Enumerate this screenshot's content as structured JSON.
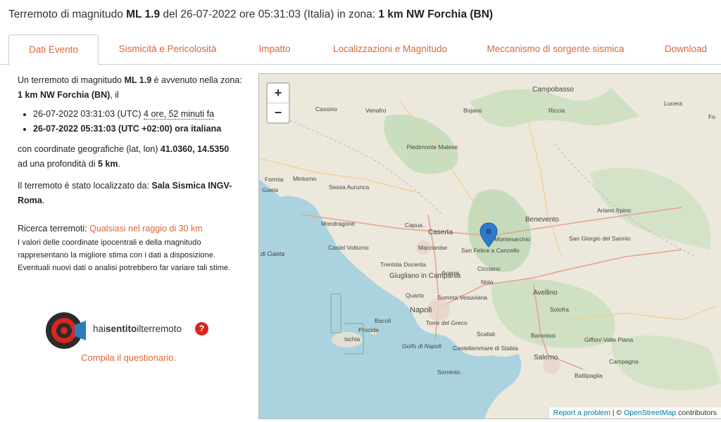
{
  "header": {
    "p1": "Terremoto di magnitudo ",
    "mag": "ML 1.9",
    "p2": " del 26-07-2022 ore 05:31:03 (Italia) in zona: ",
    "zone": "1 km NW Forchia (BN)"
  },
  "tabs": [
    {
      "label": "Dati Evento",
      "active": true
    },
    {
      "label": "Sismicità e Pericolosità"
    },
    {
      "label": "Impatto"
    },
    {
      "label": "Localizzazioni e Magnitudo"
    },
    {
      "label": "Meccanismo di sorgente sismica"
    },
    {
      "label": "Download"
    }
  ],
  "info": {
    "intro1": "Un terremoto di magnitudo ",
    "mag": "ML 1.9",
    "intro2": " è avvenuto nella zona: ",
    "zone": "1 km NW Forchia (BN)",
    "intro3": ", il",
    "utc_time": "26-07-2022 03:31:03 (UTC)",
    "ago": "4 ore, 52 minuti fa",
    "local_time": "26-07-2022 05:31:03 (UTC +02:00) ora italiana",
    "coord_text": "con coordinate geografiche (lat, lon) ",
    "coords": "41.0360, 14.5350",
    "depth_text": "ad una profondità di ",
    "depth": "5 km",
    "loc_text": "Il terremoto è stato localizzato da: ",
    "loc_by": "Sala Sismica INGV-Roma",
    "search_label": "Ricerca terremoti: ",
    "search_link": "Qualsiasi nel raggio di 30 km",
    "note": "I valori delle coordinate ipocentrali e della magnitudo rappresentano la migliore stima con i dati a disposizione. Eventuali nuovi dati o analisi potrebbero far variare tali stime."
  },
  "hst": {
    "brand_pre": "hai",
    "brand_mid": "sentito",
    "brand_suf": "ilterremoto",
    "help": "?",
    "questionnaire": "Compila il questionario."
  },
  "map": {
    "zoom_in": "+",
    "zoom_out": "−",
    "report": "Report a problem",
    "sep": " | © ",
    "osm": "OpenStreetMap",
    "contrib": " contributors",
    "places": [
      "Campobasso",
      "Cassino",
      "Venafro",
      "Bojano",
      "Riccia",
      "Lucera",
      "Fo",
      "Piedimonte Matese",
      "Formia",
      "Minturno",
      "Sessa Aurunca",
      "Benevento",
      "Ariano Irpino",
      "Gaeta",
      "Mondragone",
      "Capua",
      "Caserta",
      "Montesarchio",
      "San Giorgio del Sannio",
      "Castel Volturno",
      "Marcianise",
      "San Felice a Cancello",
      "di Gaeta",
      "Trentola Ducenta",
      "Cicciano",
      "Giugliano in Campania",
      "Acerra",
      "Nola",
      "Avellino",
      "Quarto",
      "Napoli",
      "Somma Vesuviana",
      "Solofra",
      "Bacoli",
      "Torre del Greco",
      "Procida",
      "Ischia",
      "Scafati",
      "Baronissi",
      "Giffoni Valle Piana",
      "Golfo di Napoli",
      "Castellammare di Stabia",
      "Salerno",
      "Campagna",
      "Sorrento",
      "Battipaglia"
    ]
  }
}
